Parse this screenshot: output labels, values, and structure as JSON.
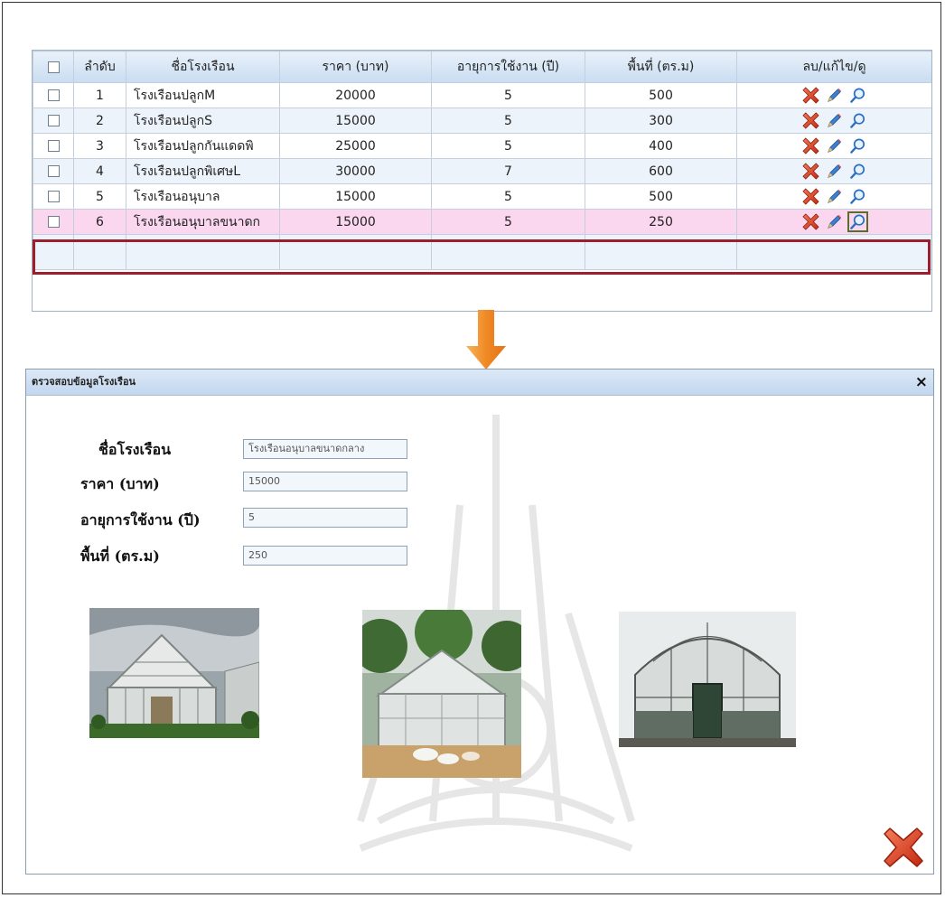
{
  "table": {
    "headers": [
      "",
      "ลำดับ",
      "ชื่อโรงเรือน",
      "ราคา (บาท)",
      "อายุการใช้งาน (ปี)",
      "พื้นที่ (ตร.ม)",
      "ลบ/แก้ไข/ดู"
    ],
    "rows": [
      {
        "no": "1",
        "name": "โรงเรือนปลูกM",
        "price": "20000",
        "life": "5",
        "area": "500"
      },
      {
        "no": "2",
        "name": "โรงเรือนปลูกS",
        "price": "15000",
        "life": "5",
        "area": "300"
      },
      {
        "no": "3",
        "name": "โรงเรือนปลูกกันแดดพิ",
        "price": "25000",
        "life": "5",
        "area": "400"
      },
      {
        "no": "4",
        "name": "โรงเรือนปลูกพิเศษL",
        "price": "30000",
        "life": "7",
        "area": "600"
      },
      {
        "no": "5",
        "name": "โรงเรือนอนุบาล",
        "price": "15000",
        "life": "5",
        "area": "500"
      },
      {
        "no": "6",
        "name": "โรงเรือนอนุบาลขนาดก",
        "price": "15000",
        "life": "5",
        "area": "250"
      }
    ],
    "selected_row": 6
  },
  "dialog": {
    "title": "ตรวจสอบข้อมูลโรงเรือน",
    "close_symbol": "×",
    "fields": [
      {
        "label": "ชื่อโรงเรือน",
        "value": "โรงเรือนอนุบาลขนาดกลาง"
      },
      {
        "label": "ราคา  (บาท)",
        "value": "15000"
      },
      {
        "label": "อายุการใช้งาน (ปี)",
        "value": "5"
      },
      {
        "label": "พื้นที่  (ตร.ม)",
        "value": "250"
      }
    ],
    "photos": [
      "greenhouse-photo-1",
      "greenhouse-photo-2",
      "greenhouse-photo-3"
    ]
  },
  "icons": {
    "delete": "delete-x-icon",
    "edit": "pencil-icon",
    "view": "magnifier-icon",
    "arrow": "down-arrow-icon",
    "close_dialog": "big-red-x-icon"
  },
  "colors": {
    "header_bg": "#c9dcf0",
    "alt_row": "#edf3fa",
    "selected_row": "#fad6ef",
    "selection_border": "#9b1f2d",
    "arrow": "#f0922a",
    "delete_red": "#d03a1e"
  }
}
